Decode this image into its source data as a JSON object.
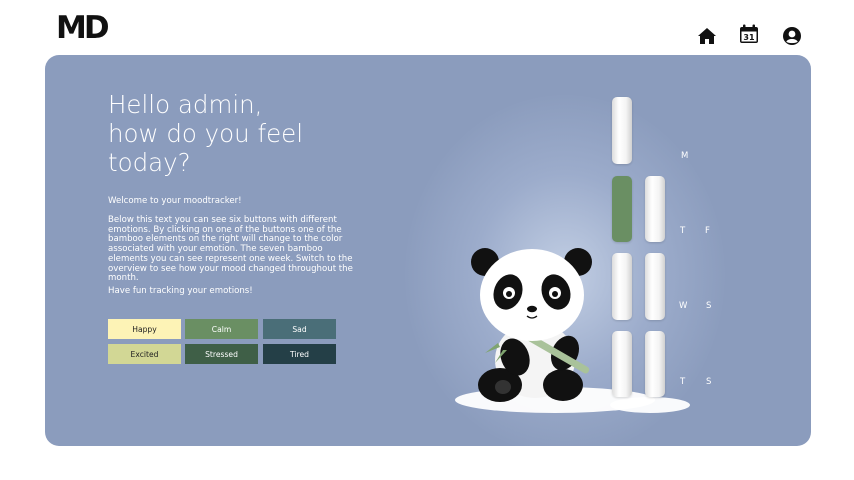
{
  "header": {
    "logo_text": "MD",
    "nav": [
      {
        "name": "home-icon"
      },
      {
        "name": "calendar-icon",
        "text": "31"
      },
      {
        "name": "user-icon"
      }
    ]
  },
  "main": {
    "greeting": [
      "Hello admin,",
      "how do you feel",
      "today?"
    ],
    "welcome": "Welcome to your moodtracker!",
    "description": "Below this text you can see six buttons with different emotions. By clicking on one of the buttons one of the bamboo elements on the right will change to the color associated with your emotion. The seven bamboo elements you can see represent one week. Switch to the overview to see how your mood changed throughout the month.",
    "closing": "Have fun tracking your emotions!",
    "moods": [
      {
        "label": "Happy",
        "color": "#fdf3b6",
        "text_color": "#222222"
      },
      {
        "label": "Calm",
        "color": "#6a8f63",
        "text_color": "#ffffff"
      },
      {
        "label": "Sad",
        "color": "#4a6e78",
        "text_color": "#ffffff"
      },
      {
        "label": "Excited",
        "color": "#d2d795",
        "text_color": "#222222"
      },
      {
        "label": "Stressed",
        "color": "#3f5f47",
        "text_color": "#ffffff"
      },
      {
        "label": "Tired",
        "color": "#243f47",
        "text_color": "#ffffff"
      }
    ]
  },
  "week": {
    "days": [
      "M",
      "T",
      "F",
      "W",
      "S",
      "T",
      "S"
    ],
    "active_color": "#6a8f63"
  }
}
